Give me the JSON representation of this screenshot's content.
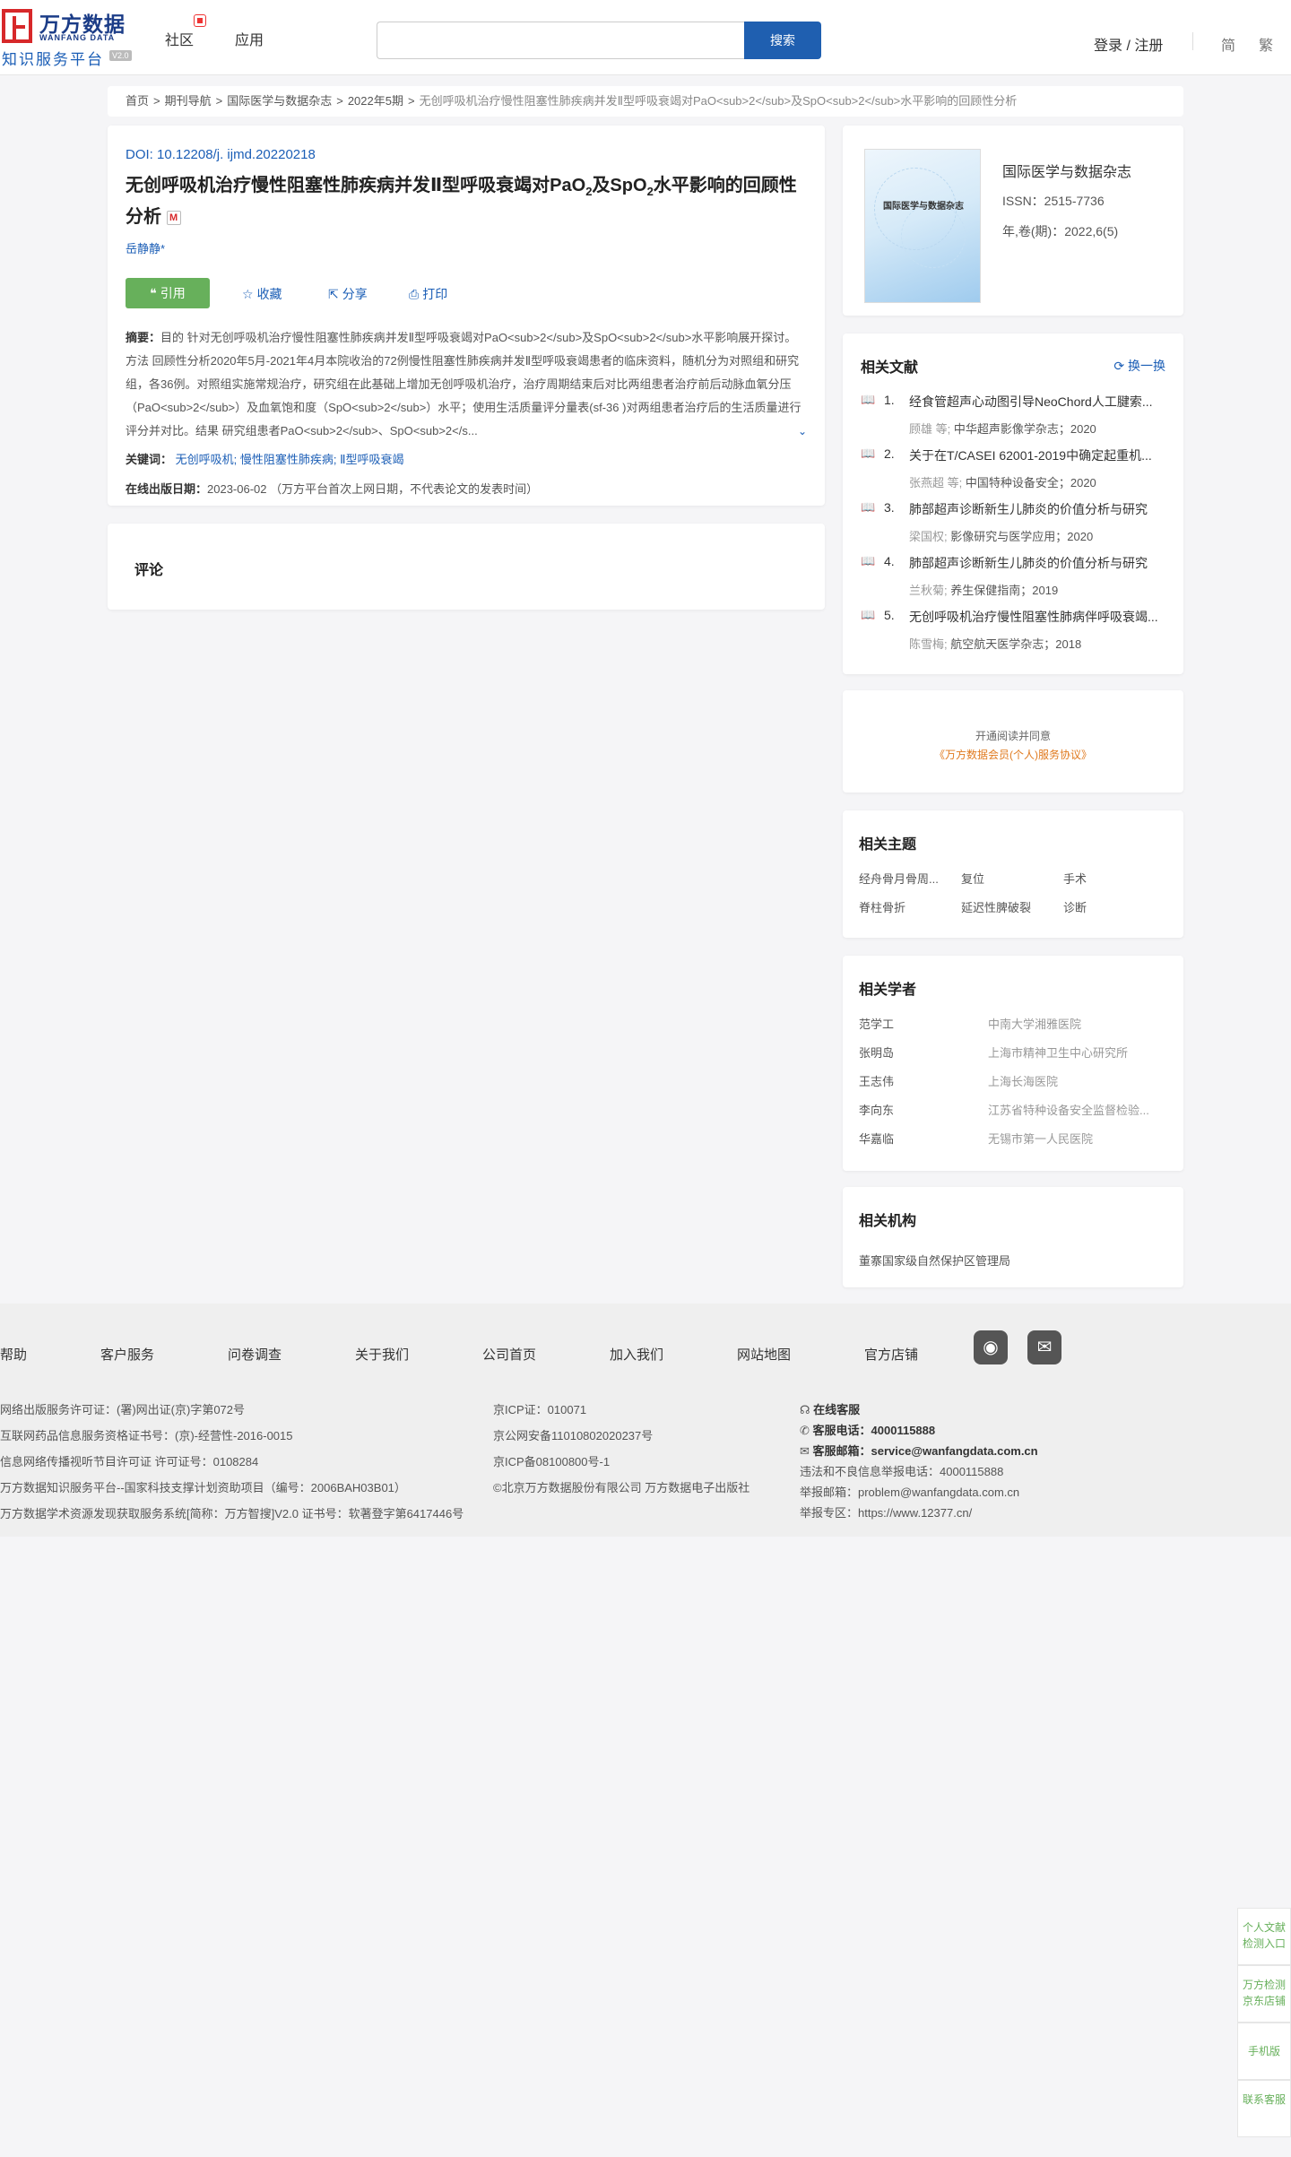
{
  "header": {
    "logo_cn": "万方数据",
    "logo_en": "WANFANG DATA",
    "logo_sub": "知识服务平台",
    "logo_version": "V2.0",
    "nav": [
      "社区",
      "应用"
    ],
    "search_placeholder": "",
    "search_button": "搜索",
    "login": "登录 / 注册",
    "lang": [
      "简",
      "繁"
    ]
  },
  "breadcrumb": {
    "items": [
      "首页",
      "期刊导航",
      "国际医学与数据杂志",
      "2022年5期"
    ],
    "current": "无创呼吸机治疗慢性阻塞性肺疾病并发Ⅱ型呼吸衰竭对PaO<sub>2</sub>及SpO<sub>2</sub>水平影响的回顾性分析"
  },
  "article": {
    "doi_label": "DOI:",
    "doi": "10.12208/j. ijmd.20220218",
    "title_parts": [
      "无创呼吸机治疗慢性阻塞性肺疾病并发Ⅱ型呼吸衰竭对PaO",
      "2",
      "及SpO",
      "2",
      "水平影响的回顾性分析"
    ],
    "m_icon": "M",
    "author": "岳静静*",
    "cite_button": "引用",
    "collect": "收藏",
    "share": "分享",
    "print": "打印",
    "abstract_label": "摘要：",
    "abstract": "目的 针对无创呼吸机治疗慢性阻塞性肺疾病并发Ⅱ型呼吸衰竭对PaO<sub>2</sub>及SpO<sub>2</sub>水平影响展开探讨。方法 回顾性分析2020年5月-2021年4月本院收治的72例慢性阻塞性肺疾病并发Ⅱ型呼吸衰竭患者的临床资料，随机分为对照组和研究组，各36例。对照组实施常规治疗，研究组在此基础上增加无创呼吸机治疗，治疗周期结束后对比两组患者治疗前后动脉血氧分压（PaO<sub>2</sub>）及血氧饱和度（SpO<sub>2</sub>）水平；使用生活质量评分量表(sf-36 )对两组患者治疗后的生活质量进行评分并对比。结果 研究组患者PaO<sub>2</sub>、SpO<sub>2</s...",
    "keywords_label": "关键词：",
    "keywords": [
      "无创呼吸机;",
      "慢性阻塞性肺疾病;",
      "Ⅱ型呼吸衰竭"
    ],
    "pubdate_label": "在线出版日期：",
    "pubdate": "2023-06-02 （万方平台首次上网日期，不代表论文的发表时间）"
  },
  "comment": {
    "title": "评论"
  },
  "journal": {
    "cover_title": "国际医学与数据杂志",
    "name": "国际医学与数据杂志",
    "issn": "ISSN：2515-7736",
    "year_issue": "年,卷(期)：2022,6(5)"
  },
  "related_docs": {
    "title": "相关文献",
    "swap": "换一换",
    "items": [
      {
        "num": "1.",
        "title": "经食管超声心动图引导NeoChord人工腱索...",
        "author": "顾雄 等;",
        "source": "中华超声影像学杂志；2020"
      },
      {
        "num": "2.",
        "title": "关于在T/CASEI 62001-2019中确定起重机...",
        "author": "张燕超 等;",
        "source": "中国特种设备安全；2020"
      },
      {
        "num": "3.",
        "title": "肺部超声诊断新生儿肺炎的价值分析与研究",
        "author": "梁国权;",
        "source": "影像研究与医学应用；2020"
      },
      {
        "num": "4.",
        "title": "肺部超声诊断新生儿肺炎的价值分析与研究",
        "author": "兰秋菊;",
        "source": "养生保健指南；2019"
      },
      {
        "num": "5.",
        "title": "无创呼吸机治疗慢性阻塞性肺病伴呼吸衰竭...",
        "author": "陈雪梅;",
        "source": "航空航天医学杂志；2018"
      }
    ]
  },
  "agreement": {
    "line1": "开通阅读并同意",
    "line2": "《万方数据会员(个人)服务协议》"
  },
  "related_topics": {
    "title": "相关主题",
    "items": [
      "经舟骨月骨周...",
      "复位",
      "手术",
      "脊柱骨折",
      "延迟性脾破裂",
      "诊断"
    ]
  },
  "related_scholars": {
    "title": "相关学者",
    "items": [
      {
        "name": "范学工",
        "org": "中南大学湘雅医院"
      },
      {
        "name": "张明岛",
        "org": "上海市精神卫生中心研究所"
      },
      {
        "name": "王志伟",
        "org": "上海长海医院"
      },
      {
        "name": "李向东",
        "org": "江苏省特种设备安全监督检验..."
      },
      {
        "name": "华嘉临",
        "org": "无锡市第一人民医院"
      }
    ]
  },
  "related_orgs": {
    "title": "相关机构",
    "items": [
      "董寨国家级自然保护区管理局"
    ]
  },
  "footer": {
    "nav": [
      "帮助",
      "客户服务",
      "问卷调查",
      "关于我们",
      "公司首页",
      "加入我们",
      "网站地图",
      "官方店铺"
    ],
    "col1": [
      "网络出版服务许可证：(署)网出证(京)字第072号",
      "互联网药品信息服务资格证书号：(京)-经营性-2016-0015",
      "信息网络传播视听节目许可证 许可证号：0108284",
      "万方数据知识服务平台--国家科技支撑计划资助项目（编号：2006BAH03B01）",
      "万方数据学术资源发现获取服务系统[简称：万方智搜]V2.0 证书号：软著登字第6417446号"
    ],
    "col2": [
      "京ICP证：010071",
      "京公网安备11010802020237号",
      "京ICP备08100800号-1",
      "©北京万方数据股份有限公司 万方数据电子出版社"
    ],
    "col3": {
      "online": "在线客服",
      "phone_label": "客服电话：",
      "phone": "4000115888",
      "email_label": "客服邮箱：",
      "email": "service@wanfangdata.com.cn",
      "report_phone": "违法和不良信息举报电话：4000115888",
      "report_email": "举报邮箱：problem@wanfangdata.com.cn",
      "report_area": "举报专区：https://www.12377.cn/"
    }
  },
  "floating": [
    "个人文献检测入口",
    "万方检测京东店铺",
    "手机版",
    "联系客服"
  ]
}
